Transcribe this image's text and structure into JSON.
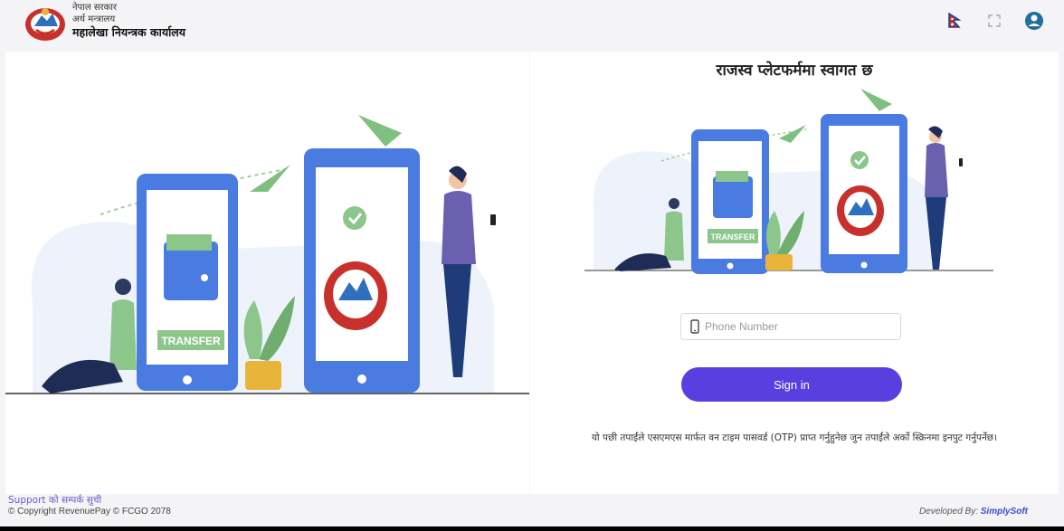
{
  "header": {
    "org_line1": "नेपाल सरकार",
    "org_line2": "अर्थ मन्त्रालय",
    "org_line3": "महालेखा नियन्त्रक कार्यालय",
    "icons": [
      "nepal-flag-icon",
      "fullscreen-icon",
      "user-avatar-icon"
    ]
  },
  "hero": {
    "transfer_label": "TRANSFER"
  },
  "login": {
    "title": "राजस्व प्लेटफर्ममा स्वागत छ",
    "phone_placeholder": "Phone Number",
    "phone_value": "",
    "signin_label": "Sign in",
    "otp_note": "यो पछी तपाईंले एसएमएस मार्फत वन टाइम पासवर्ड (OTP) प्राप्त गर्नुहुनेछ जुन तपाईंले अर्को स्क्रिनमा इनपुट गर्नुपर्नेछ।"
  },
  "footer": {
    "support_text": "Support को सम्पर्क सुची",
    "copyright": "© Copyright RevenuePay © FCGO 2078",
    "developed_by_prefix": "Developed By: ",
    "developer": "SimplySoft"
  },
  "colors": {
    "accent": "#5a3fe0",
    "phone_blue": "#4a7be0",
    "plant_green": "#8cc68a",
    "woman_shirt": "#6b5fb0"
  }
}
